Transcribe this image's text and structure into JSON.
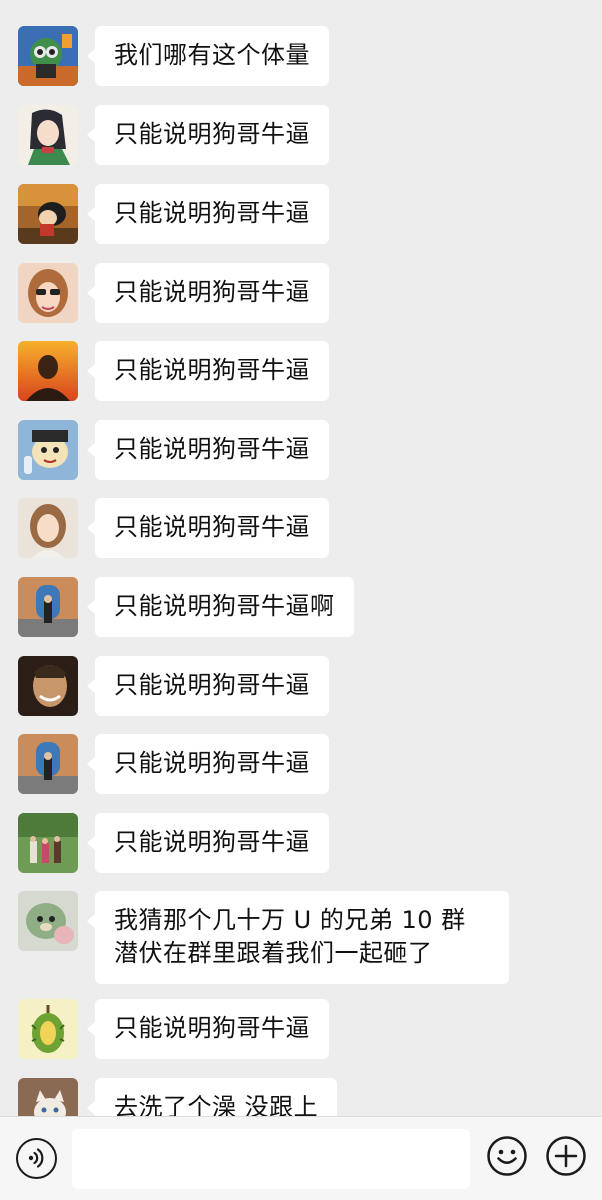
{
  "messages": [
    {
      "avatar": "robot-mascot-avatar",
      "text": "我们哪有这个体量"
    },
    {
      "avatar": "anime-girl-avatar",
      "text": "只能说明狗哥牛逼"
    },
    {
      "avatar": "cartoon-boy-sunset-avatar",
      "text": "只能说明狗哥牛逼"
    },
    {
      "avatar": "woman-sunglasses-avatar",
      "text": "只能说明狗哥牛逼"
    },
    {
      "avatar": "sunset-portrait-avatar",
      "text": "只能说明狗哥牛逼"
    },
    {
      "avatar": "cartoon-character-avatar",
      "text": "只能说明狗哥牛逼"
    },
    {
      "avatar": "woman-portrait-avatar",
      "text": "只能说明狗哥牛逼"
    },
    {
      "avatar": "doorway-photo-avatar",
      "text": "只能说明狗哥牛逼啊"
    },
    {
      "avatar": "smiling-man-avatar",
      "text": "只能说明狗哥牛逼"
    },
    {
      "avatar": "doorway-photo-avatar",
      "text": "只能说明狗哥牛逼"
    },
    {
      "avatar": "group-photo-avatar",
      "text": "只能说明狗哥牛逼"
    },
    {
      "avatar": "plush-toy-avatar",
      "text": "我猜那个几十万 U 的兄弟 10 群潜伏在群里跟着我们一起砸了"
    },
    {
      "avatar": "durian-avatar",
      "text": "只能说明狗哥牛逼"
    },
    {
      "avatar": "cat-avatar",
      "text": "去洗了个澡 没跟上"
    }
  ],
  "input_bar": {
    "voice_icon": "voice-icon",
    "input_value": "",
    "emoji_icon": "emoji-icon",
    "plus_icon": "plus-icon"
  },
  "colors": {
    "background": "#ededed",
    "bubble": "#ffffff",
    "text": "#111111",
    "bar": "#f6f6f6"
  }
}
